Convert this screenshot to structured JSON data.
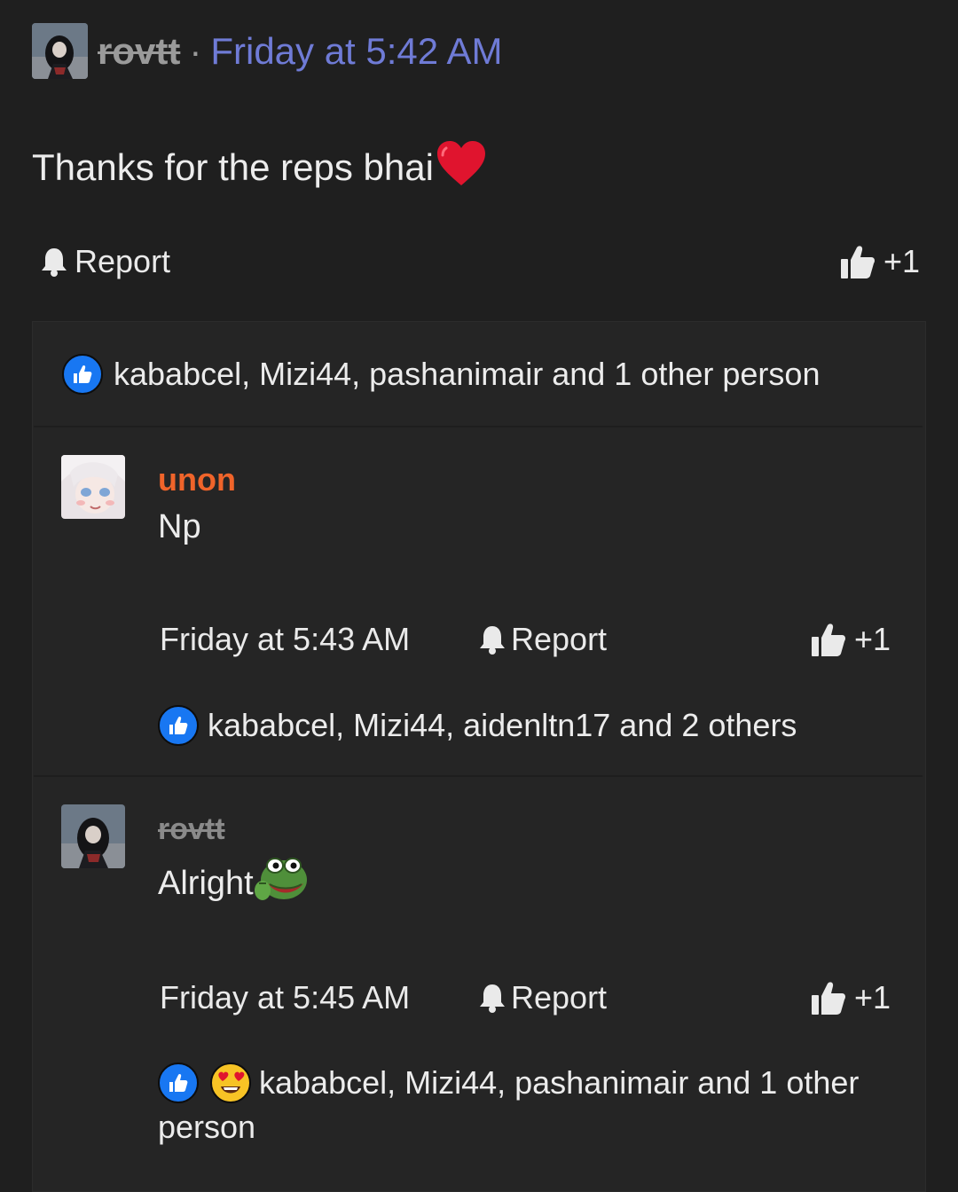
{
  "post": {
    "author": "rovtt",
    "separator": "·",
    "timestamp": "Friday at 5:42 AM",
    "text": "Thanks for the reps bhai",
    "report_label": "Report",
    "plus_label": "+1",
    "reactions_summary": "kababcel, Mizi44, pashanimair and 1 other person"
  },
  "replies": [
    {
      "author": "unon",
      "author_color": "#f0642a",
      "text": "Np",
      "timestamp": "Friday at 5:43 AM",
      "report_label": "Report",
      "plus_label": "+1",
      "reactions_summary": "kababcel, Mizi44, aidenltn17 and 2 others"
    },
    {
      "author": "rovtt",
      "author_color": "#8a8a8a",
      "text": "Alright",
      "timestamp": "Friday at 5:45 AM",
      "report_label": "Report",
      "plus_label": "+1",
      "reactions_summary_line1": "kababcel, Mizi44, pashanimair and 1 other",
      "reactions_summary_line2": "person"
    }
  ],
  "icons": {
    "report": "bell-icon",
    "like": "thumbs-up-icon",
    "heart": "red-heart-emoji",
    "love": "heart-eyes-emoji",
    "pepe": "pepe-frog-emoji"
  },
  "colors": {
    "background": "#1f1f1f",
    "panel": "#252525",
    "link": "#6f7bd6",
    "like_blue": "#1877f2",
    "heart_red": "#e0142e"
  }
}
